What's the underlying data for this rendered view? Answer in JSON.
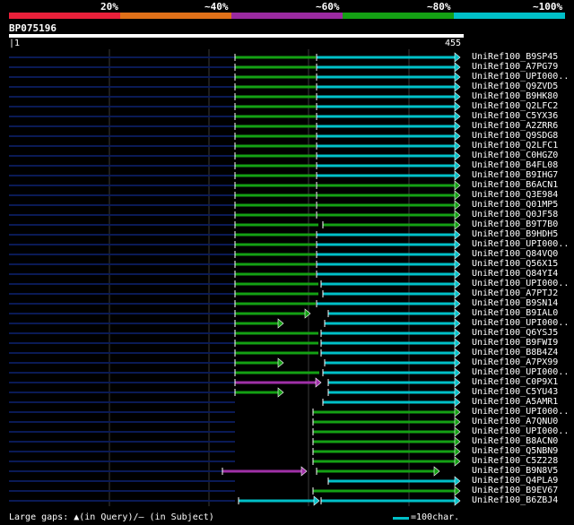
{
  "legend": {
    "labels": [
      "20%",
      "~40%",
      "~60%",
      "~80%",
      "~100%"
    ],
    "colors": [
      "#e8203a",
      "#e07018",
      "#9a2aa0",
      "#14a014",
      "#00c0c8"
    ]
  },
  "query": {
    "id": "BP075196",
    "start": "1",
    "end": "455"
  },
  "hits": [
    "UniRef100_B9SP45",
    "UniRef100_A7PG79",
    "UniRef100_UPI000..",
    "UniRef100_Q9ZVD5",
    "UniRef100_B9HK80",
    "UniRef100_Q2LFC2",
    "UniRef100_C5YX36",
    "UniRef100_A2ZRR6",
    "UniRef100_Q9SDG8",
    "UniRef100_Q2LFC1",
    "UniRef100_C0HGZ0",
    "UniRef100_B4FL08",
    "UniRef100_B9IHG7",
    "UniRef100_B6ACN1",
    "UniRef100_Q3E984",
    "UniRef100_Q01MP5",
    "UniRef100_Q0JF58",
    "UniRef100_B9T7B0",
    "UniRef100_B9HDH5",
    "UniRef100_UPI000..",
    "UniRef100_Q84VQ0",
    "UniRef100_Q56X15",
    "UniRef100_Q84YI4",
    "UniRef100_UPI000..",
    "UniRef100_A7PTJ2",
    "UniRef100_B9SN14",
    "UniRef100_B9IAL0",
    "UniRef100_UPI000..",
    "UniRef100_Q6YSJ5",
    "UniRef100_B9FWI9",
    "UniRef100_B8B4Z4",
    "UniRef100_A7PX99",
    "UniRef100_UPI000..",
    "UniRef100_C0P9X1",
    "UniRef100_C5YU43",
    "UniRef100_A5AMR1",
    "UniRef100_UPI000..",
    "UniRef100_A7QNU0",
    "UniRef100_UPI000..",
    "UniRef100_B8ACN0",
    "UniRef100_Q5NBN9",
    "UniRef100_C5Z228",
    "UniRef100_B9N8V5",
    "UniRef100_Q4PLA9",
    "UniRef100_B9EV67",
    "UniRef100_B6ZBJ4"
  ],
  "footer": {
    "gaps_note": "Large gaps: ▲(in Query)/‒ (in Subject)",
    "scale_note": "=100char."
  }
}
